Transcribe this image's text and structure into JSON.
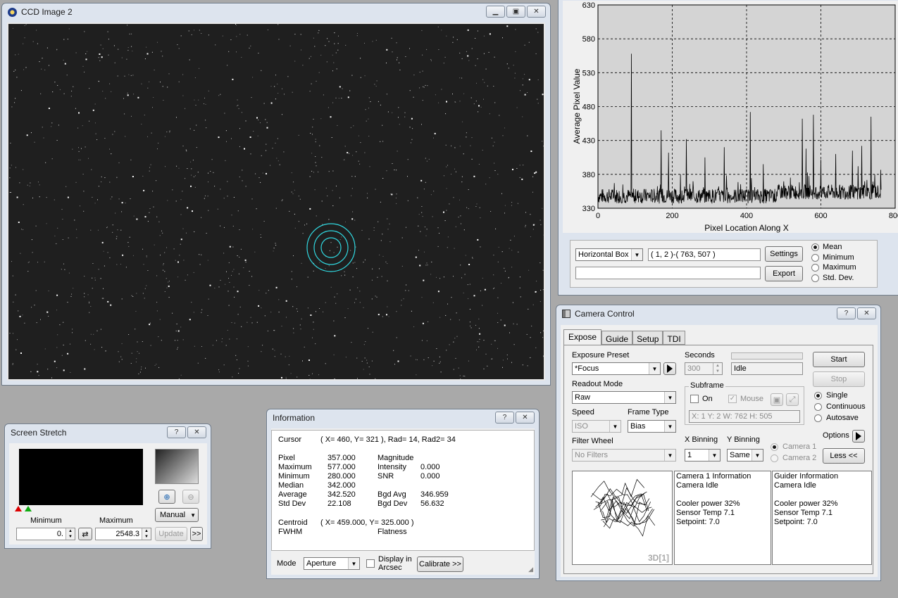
{
  "ccd": {
    "title": "CCD Image 2"
  },
  "plot": {
    "ylabel": "Average Pixel Value",
    "xlabel": "Pixel Location Along X",
    "yticks": [
      "630",
      "580",
      "530",
      "480",
      "430",
      "380",
      "330"
    ],
    "xticks": [
      "0",
      "200",
      "400",
      "600",
      "800"
    ],
    "profile_type": "Horizontal Box",
    "coords": "( 1, 2 )-( 763, 507 )",
    "settings_label": "Settings",
    "export_label": "Export",
    "stats": [
      "Mean",
      "Minimum",
      "Maximum",
      "Std. Dev."
    ],
    "selected_stat": "Mean"
  },
  "chart_data": {
    "type": "line",
    "xlabel": "Pixel Location Along X",
    "ylabel": "Average Pixel Value",
    "xlim": [
      0,
      800
    ],
    "ylim": [
      330,
      630
    ],
    "grid": true,
    "baseline_approx": 348,
    "peaks": [
      {
        "x": 90,
        "y": 558
      },
      {
        "x": 170,
        "y": 445
      },
      {
        "x": 190,
        "y": 412
      },
      {
        "x": 222,
        "y": 380
      },
      {
        "x": 238,
        "y": 432
      },
      {
        "x": 288,
        "y": 405
      },
      {
        "x": 340,
        "y": 420
      },
      {
        "x": 410,
        "y": 472
      },
      {
        "x": 445,
        "y": 395
      },
      {
        "x": 550,
        "y": 462
      },
      {
        "x": 560,
        "y": 418
      },
      {
        "x": 580,
        "y": 468
      },
      {
        "x": 600,
        "y": 402
      },
      {
        "x": 640,
        "y": 410
      },
      {
        "x": 685,
        "y": 415
      },
      {
        "x": 700,
        "y": 392
      },
      {
        "x": 710,
        "y": 422
      },
      {
        "x": 735,
        "y": 465
      },
      {
        "x": 745,
        "y": 380
      }
    ]
  },
  "stretch": {
    "title": "Screen Stretch",
    "min_label": "Minimum",
    "max_label": "Maximum",
    "min_value": "0.",
    "max_value": "2548.3",
    "mode": "Manual",
    "update_label": "Update",
    "more_label": ">>"
  },
  "info": {
    "title": "Information",
    "cursor_label": "Cursor",
    "cursor_value": "( X=  460, Y=  321 ), Rad= 14, Rad2= 34",
    "rows_left": [
      {
        "label": "Pixel",
        "value": "357.000"
      },
      {
        "label": "Maximum",
        "value": "577.000"
      },
      {
        "label": "Minimum",
        "value": "280.000"
      },
      {
        "label": "Median",
        "value": "342.000"
      },
      {
        "label": "Average",
        "value": "342.520"
      },
      {
        "label": "Std Dev",
        "value": "22.108"
      }
    ],
    "rows_right": [
      {
        "label": "Magnitude",
        "value": ""
      },
      {
        "label": "Intensity",
        "value": "0.000"
      },
      {
        "label": "SNR",
        "value": "0.000"
      },
      {
        "label": "",
        "value": ""
      },
      {
        "label": "Bgd Avg",
        "value": "346.959"
      },
      {
        "label": "Bgd Dev",
        "value": "56.632"
      }
    ],
    "centroid_label": "Centroid",
    "centroid_value": "( X= 459.000, Y=  325.000 )",
    "fwhm_label": "FWHM",
    "flatness_label": "Flatness",
    "mode_label": "Mode",
    "mode_value": "Aperture",
    "display_arcsec": "Display in Arcsec",
    "calibrate_label": "Calibrate >>"
  },
  "camera": {
    "title": "Camera Control",
    "tabs": [
      "Expose",
      "Guide",
      "Setup",
      "TDI"
    ],
    "active_tab": "Expose",
    "exposure_preset_label": "Exposure Preset",
    "exposure_preset": "*Focus",
    "seconds_label": "Seconds",
    "seconds_value": "300",
    "status": "Idle",
    "start_label": "Start",
    "stop_label": "Stop",
    "readout_label": "Readout Mode",
    "readout_value": "Raw",
    "subframe_label": "Subframe",
    "on_label": "On",
    "mouse_label": "Mouse",
    "subframe_coords": "X:   1 Y:   2 W: 762 H: 505",
    "modes": [
      "Single",
      "Continuous",
      "Autosave"
    ],
    "selected_mode": "Single",
    "speed_label": "Speed",
    "speed_value": "ISO",
    "frame_type_label": "Frame Type",
    "frame_type_value": "Bias",
    "filter_wheel_label": "Filter Wheel",
    "filter_value": "No Filters",
    "xbin_label": "X Binning",
    "xbin_value": "1",
    "ybin_label": "Y Binning",
    "ybin_value": "Same",
    "cam1_label": "Camera 1",
    "cam2_label": "Camera 2",
    "options_label": "Options",
    "less_label": "Less <<",
    "view3d_label": "3D[1]",
    "cam1_info": [
      "Camera 1 Information",
      "Camera Idle",
      "",
      "Cooler power 32%",
      "Sensor Temp 7.1",
      "Setpoint: 7.0"
    ],
    "guider_info": [
      "Guider Information",
      "Camera Idle",
      "",
      "Cooler power 32%",
      "Sensor Temp 7.1",
      "Setpoint: 7.0"
    ]
  }
}
